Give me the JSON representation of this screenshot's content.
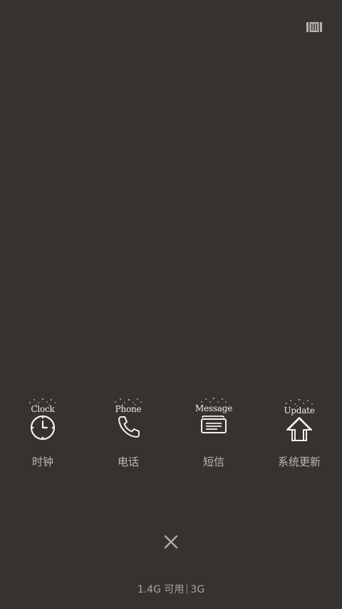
{
  "apps": [
    {
      "name": "clock",
      "icon": "clock-icon",
      "icon_text": "Clock",
      "label": "时钟"
    },
    {
      "name": "phone",
      "icon": "phone-icon",
      "icon_text": "Phone",
      "label": "电话"
    },
    {
      "name": "message",
      "icon": "message-icon",
      "icon_text": "Message",
      "label": "短信"
    },
    {
      "name": "update",
      "icon": "update-icon",
      "icon_text": "Update",
      "label": "系统更新"
    }
  ],
  "memory": {
    "available": "1.4G 可用",
    "extra": "3G"
  },
  "colors": {
    "background": "#37322d",
    "icon": "#f2efea",
    "label": "#bdb8b1"
  }
}
